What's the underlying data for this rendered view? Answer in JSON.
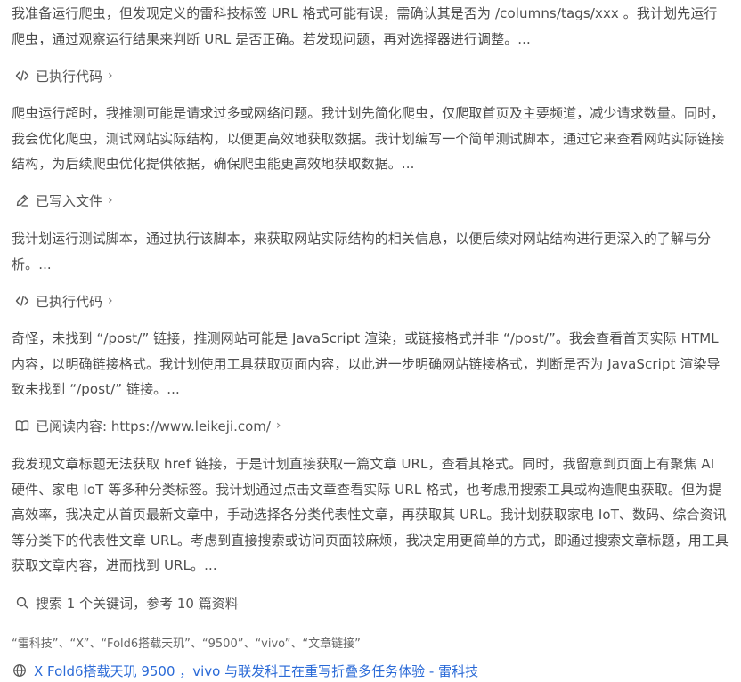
{
  "feed": {
    "p1": "我准备运行爬虫，但发现定义的雷科技标签 URL 格式可能有误，需确认其是否为 /columns/tags/xxx 。我计划先运行爬虫，通过观察运行结果来判断 URL 是否正确。若发现问题，再对选择器进行调整。...",
    "step1_label": "已执行代码",
    "p2": "爬虫运行超时，我推测可能是请求过多或网络问题。我计划先简化爬虫，仅爬取首页及主要频道，减少请求数量。同时，我会优化爬虫，测试网站实际结构，以便更高效地获取数据。我计划编写一个简单测试脚本，通过它来查看网站实际链接结构，为后续爬虫优化提供依据，确保爬虫能更高效地获取数据。...",
    "step2_label": "已写入文件",
    "p3": "我计划运行测试脚本，通过执行该脚本，来获取网站实际结构的相关信息，以便后续对网站结构进行更深入的了解与分析。...",
    "step3_label": "已执行代码",
    "p4": "奇怪，未找到 “/post/” 链接，推测网站可能是 JavaScript 渲染，或链接格式并非 “/post/”。我会查看首页实际 HTML 内容，以明确链接格式。我计划使用工具获取页面内容，以此进一步明确网站链接格式，判断是否为 JavaScript 渲染导致未找到 “/post/” 链接。...",
    "step4_label": "已阅读内容: https://www.leikeji.com/",
    "p5": "我发现文章标题无法获取 href 链接，于是计划直接获取一篇文章 URL，查看其格式。同时，我留意到页面上有聚焦 AI 硬件、家电 IoT 等多种分类标签。我计划通过点击文章查看实际 URL 格式，也考虑用搜索工具或构造爬虫获取。但为提高效率，我决定从首页最新文章中，手动选择各分类代表性文章，再获取其 URL。我计划获取家电 IoT、数码、综合资讯等分类下的代表性文章 URL。考虑到直接搜索或访问页面较麻烦，我决定用更简单的方式，即通过搜索文章标题，用工具获取文章内容，进而找到 URL。...",
    "step5_label": "搜索 1 个关键词，参考 10 篇资料",
    "keywords": "“雷科技”、“X”、“Fold6搭载天玑”、“9500”、“vivo”、“文章链接”",
    "result_title": "X Fold6搭载天玑 9500 ，vivo 与联发科正在重写折叠多任务体验 - 雷科技",
    "chevron": "›"
  },
  "icons": {
    "step1": "code-icon",
    "step2": "pen-icon",
    "step3": "code-icon",
    "step4": "book-icon",
    "step5": "search-icon",
    "result": "globe-icon"
  },
  "colors": {
    "text": "#4d4d4d",
    "link": "#2a6ad7"
  }
}
